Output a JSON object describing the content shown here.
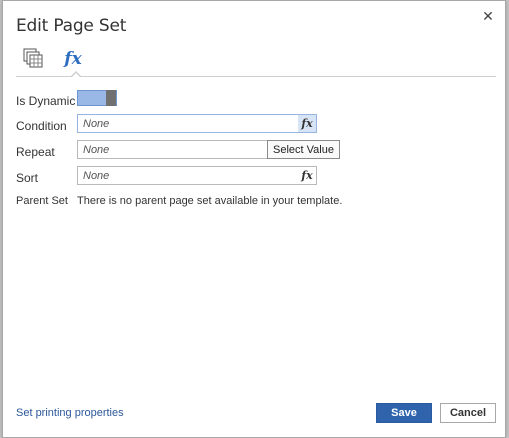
{
  "dialog": {
    "title": "Edit Page Set",
    "close_symbol": "✕"
  },
  "tabs": [
    {
      "name": "pages",
      "icon": "stacked-pages-icon",
      "active": false
    },
    {
      "name": "fx",
      "glyph": "fx",
      "icon": "function-icon",
      "active": true
    }
  ],
  "form": {
    "is_dynamic": {
      "label": "Is Dynamic",
      "value": true
    },
    "condition": {
      "label": "Condition",
      "placeholder": "None",
      "fx": "fx"
    },
    "repeat": {
      "label": "Repeat",
      "placeholder": "None",
      "tooltip": "Select Value"
    },
    "sort": {
      "label": "Sort",
      "placeholder": "None",
      "fx": "fx"
    },
    "parent_set": {
      "label": "Parent Set",
      "value": "There is no parent page set available in your template."
    }
  },
  "footer": {
    "link": "Set printing properties",
    "save": "Save",
    "cancel": "Cancel"
  },
  "colors": {
    "accent": "#2f64ad",
    "toggle_on": "#9ab8e6",
    "link": "#2b579a"
  }
}
